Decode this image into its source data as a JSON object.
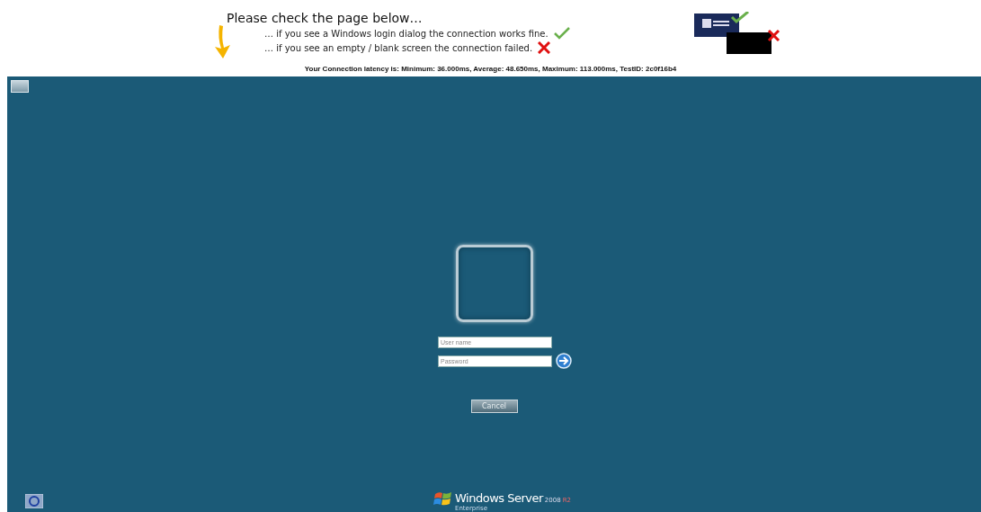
{
  "instructions": {
    "title": "Please check the page below…",
    "lines": [
      {
        "text": "… if you see a Windows login dialog the connection works fine.",
        "kind": "ok"
      },
      {
        "text": "… if you see an empty / blank screen the connection failed.",
        "kind": "fail"
      }
    ]
  },
  "latency": "Your Connection latency is: Minimum: 36.000ms, Average: 48.650ms, Maximum: 113.000ms, TestID: 2c0f16b4",
  "login": {
    "username": {
      "placeholder": "User name"
    },
    "password": {
      "placeholder": "Password"
    },
    "cancel": "Cancel"
  },
  "branding": {
    "product": "Windows Server",
    "version": "2008",
    "release": "R2",
    "edition": "Enterprise"
  }
}
